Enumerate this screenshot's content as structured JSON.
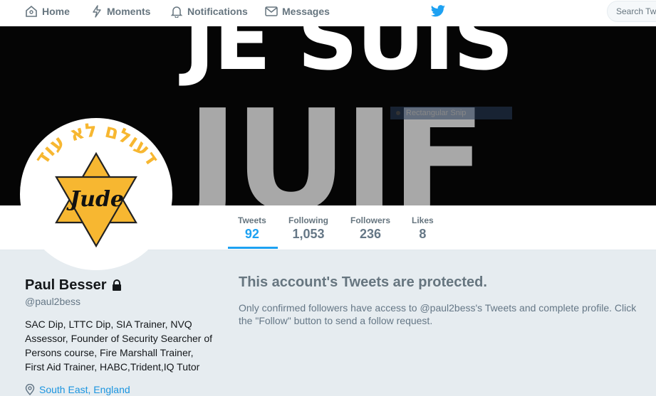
{
  "nav": {
    "home": "Home",
    "moments": "Moments",
    "notifications": "Notifications",
    "messages": "Messages"
  },
  "search": {
    "placeholder": "Search Twi"
  },
  "banner": {
    "line1": "JE SUIS",
    "line2": "JUIF",
    "snip_label": "Rectangular Snip"
  },
  "avatar": {
    "hebrew": "דעולם לא עוד",
    "badge": "Jude"
  },
  "stats": [
    {
      "label": "Tweets",
      "value": "92"
    },
    {
      "label": "Following",
      "value": "1,053"
    },
    {
      "label": "Followers",
      "value": "236"
    },
    {
      "label": "Likes",
      "value": "8"
    }
  ],
  "profile": {
    "name": "Paul Besser",
    "handle": "@paul2bess",
    "bio": "SAC Dip, LTTC Dip, SIA Trainer, NVQ Assessor, Founder of Security Searcher of Persons course, Fire Marshall Trainer, First Aid Trainer, HABC,Trident,IQ Tutor",
    "location": "South East, England"
  },
  "protected": {
    "title": "This account's Tweets are protected.",
    "text": "Only confirmed followers have access to @paul2bess's Tweets and complete profile. Click the \"Follow\" button to send a follow request."
  },
  "colors": {
    "accent": "#1da1f2",
    "star": "#f7b731"
  }
}
